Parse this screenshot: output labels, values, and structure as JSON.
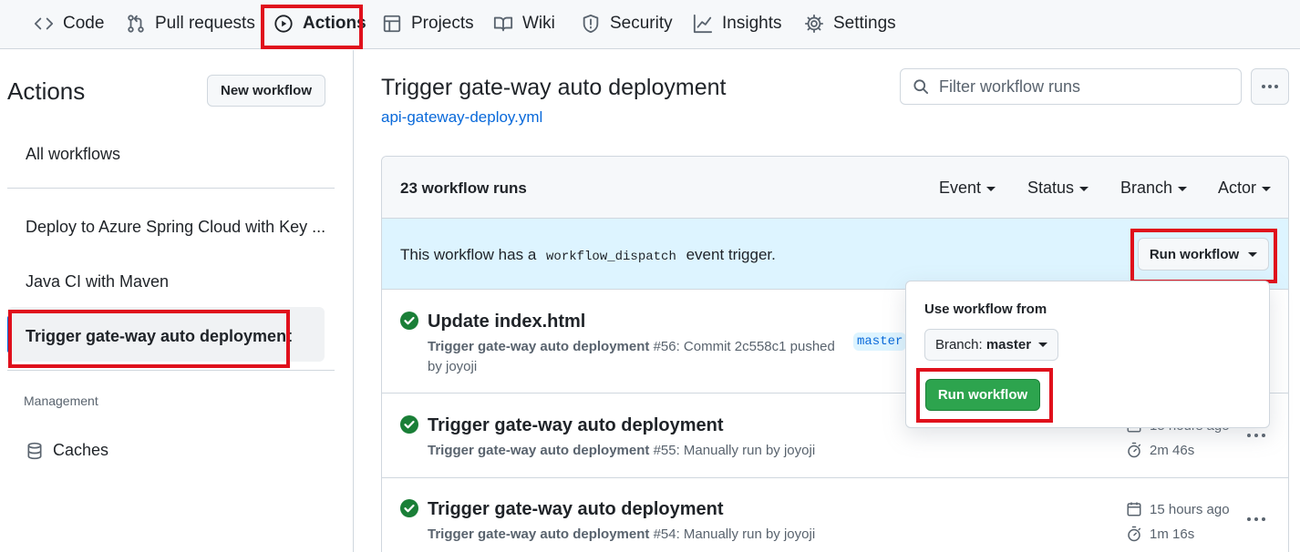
{
  "nav": {
    "tabs": [
      {
        "label": "Code",
        "icon": "code-icon"
      },
      {
        "label": "Pull requests",
        "icon": "pull-request-icon"
      },
      {
        "label": "Actions",
        "icon": "play-icon",
        "active": true
      },
      {
        "label": "Projects",
        "icon": "table-icon"
      },
      {
        "label": "Wiki",
        "icon": "book-icon"
      },
      {
        "label": "Security",
        "icon": "shield-icon"
      },
      {
        "label": "Insights",
        "icon": "graph-icon"
      },
      {
        "label": "Settings",
        "icon": "gear-icon"
      }
    ]
  },
  "sidebar": {
    "title": "Actions",
    "new_workflow": "New workflow",
    "all_workflows": "All workflows",
    "workflows": [
      "Deploy to Azure Spring Cloud with Key ...",
      "Java CI with Maven",
      "Trigger gate-way auto deployment"
    ],
    "selected_index": 2,
    "management_heading": "Management",
    "caches": "Caches"
  },
  "main": {
    "title": "Trigger gate-way auto deployment",
    "file_link": "api-gateway-deploy.yml",
    "search_placeholder": "Filter workflow runs",
    "runs_count": "23 workflow runs",
    "filters": [
      "Event",
      "Status",
      "Branch",
      "Actor"
    ],
    "dispatch": {
      "prefix": "This workflow has a",
      "code": "workflow_dispatch",
      "suffix": "event trigger.",
      "button": "Run workflow"
    },
    "runs": [
      {
        "title": "Update index.html",
        "workflow": "Trigger gate-way auto deployment",
        "detail": "#56: Commit 2c558c1 pushed",
        "detail2": "by joyoji",
        "branch": "master"
      },
      {
        "title": "Trigger gate-way auto deployment",
        "workflow": "Trigger gate-way auto deployment",
        "detail": "#55: Manually run by joyoji",
        "time": "15 hours ago",
        "duration": "2m 46s"
      },
      {
        "title": "Trigger gate-way auto deployment",
        "workflow": "Trigger gate-way auto deployment",
        "detail": "#54: Manually run by joyoji",
        "time": "15 hours ago",
        "duration": "1m 16s"
      }
    ]
  },
  "popover": {
    "label": "Use workflow from",
    "branch_prefix": "Branch:",
    "branch_value": "master",
    "run_button": "Run workflow"
  },
  "colors": {
    "accent": "#0969da",
    "success": "#1a7f37",
    "highlight_box": "#e0101c",
    "dispatch_bg": "#ddf4ff"
  }
}
